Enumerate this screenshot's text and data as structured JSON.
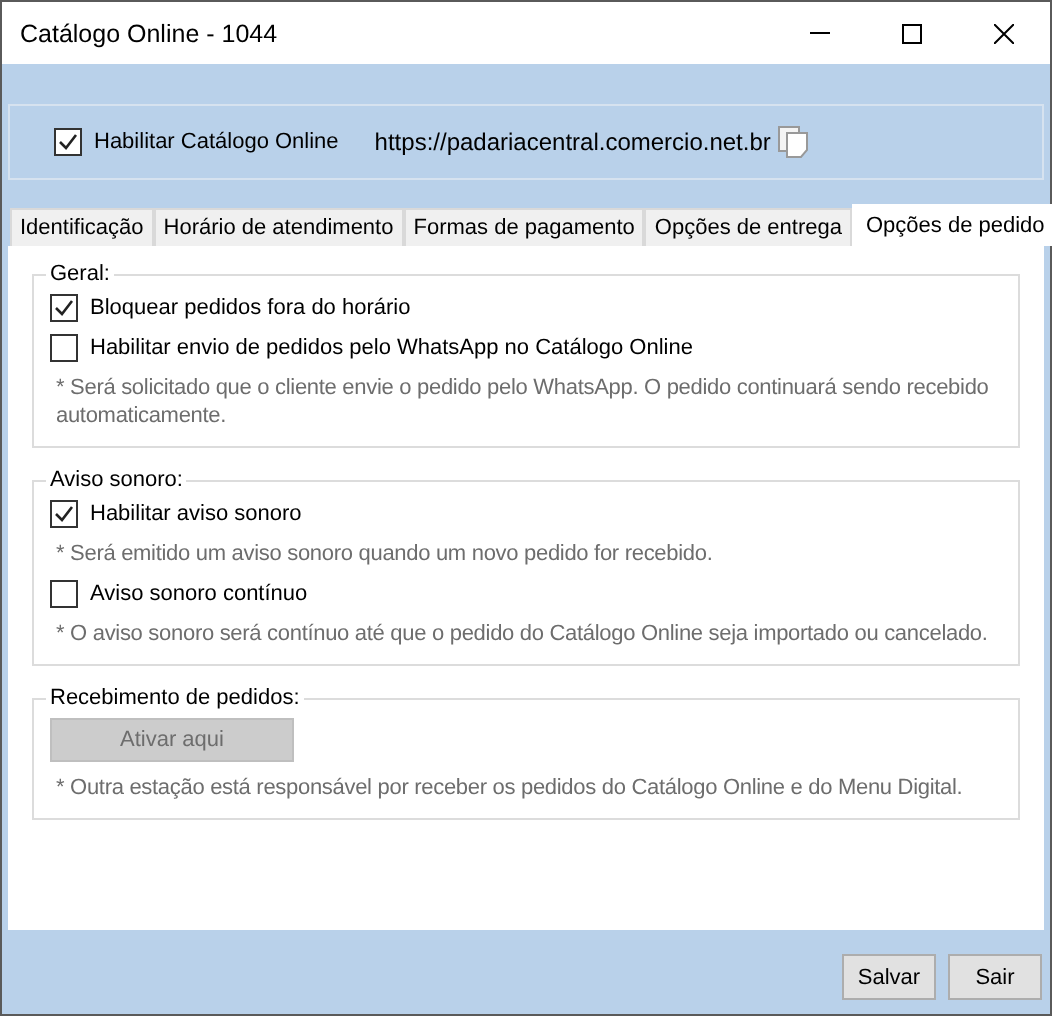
{
  "window": {
    "title": "Catálogo Online - 1044"
  },
  "header": {
    "enable": {
      "label": "Habilitar Catálogo Online",
      "checked": true
    },
    "url": "https://padariacentral.comercio.net.br"
  },
  "tabs": [
    {
      "label": "Identificação",
      "selected": false
    },
    {
      "label": "Horário de atendimento",
      "selected": false
    },
    {
      "label": "Formas de pagamento",
      "selected": false
    },
    {
      "label": "Opções de entrega",
      "selected": false
    },
    {
      "label": "Opções de pedido",
      "selected": true
    }
  ],
  "groups": [
    {
      "title": "Geral:",
      "items": [
        {
          "kind": "checkbox",
          "label": "Bloquear pedidos fora do horário",
          "checked": true
        },
        {
          "kind": "checkbox",
          "label": "Habilitar envio de pedidos pelo WhatsApp no Catálogo Online",
          "checked": false
        },
        {
          "kind": "note",
          "text": "* Será solicitado que o cliente envie o pedido pelo WhatsApp. O pedido continuará sendo recebido automaticamente."
        }
      ]
    },
    {
      "title": "Aviso sonoro:",
      "items": [
        {
          "kind": "checkbox",
          "label": "Habilitar aviso sonoro",
          "checked": true
        },
        {
          "kind": "note",
          "text": "* Será emitido um aviso sonoro quando um novo pedido for recebido."
        },
        {
          "kind": "checkbox",
          "label": "Aviso sonoro contínuo",
          "checked": false
        },
        {
          "kind": "note",
          "text": "* O aviso sonoro será contínuo até que o pedido do Catálogo Online seja importado ou cancelado."
        }
      ]
    },
    {
      "title": "Recebimento de pedidos:",
      "items": [
        {
          "kind": "button",
          "label": "Ativar aqui",
          "disabled": true
        },
        {
          "kind": "note",
          "text": "* Outra estação está responsável por receber os pedidos do Catálogo Online e do Menu Digital."
        }
      ]
    }
  ],
  "buttons": [
    "Salvar",
    "Sair"
  ]
}
